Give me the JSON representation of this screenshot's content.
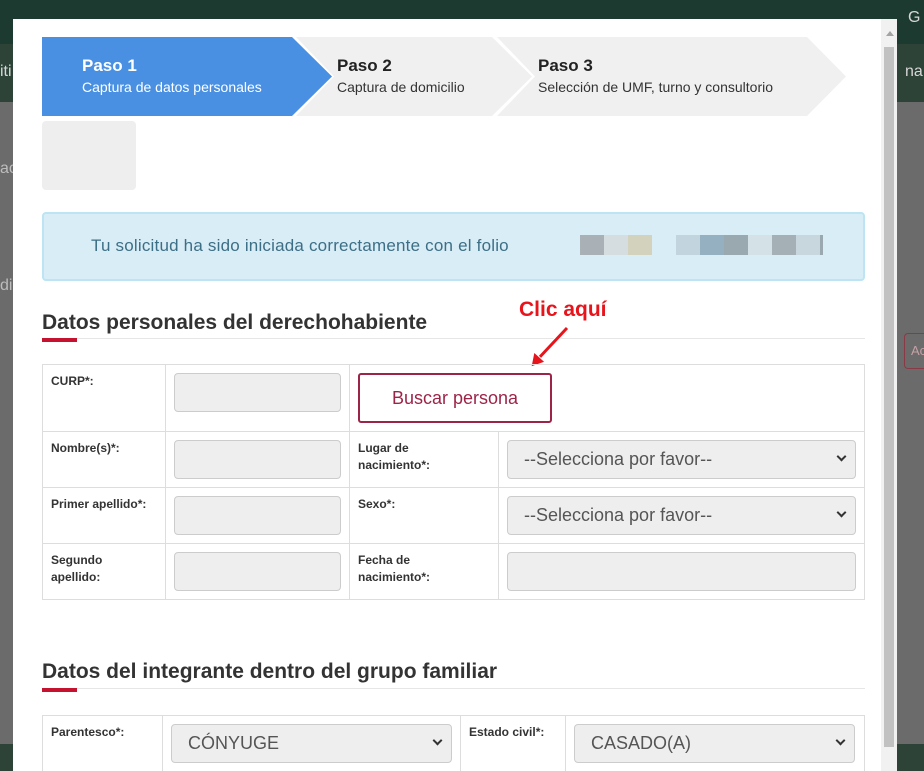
{
  "background": {
    "fragments": [
      "G",
      "iti",
      "na",
      "ac",
      "dig",
      "Ac"
    ]
  },
  "stepper": [
    {
      "title": "Paso 1",
      "subtitle": "Captura de datos personales",
      "active": true
    },
    {
      "title": "Paso 2",
      "subtitle": "Captura de domicilio",
      "active": false
    },
    {
      "title": "Paso 3",
      "subtitle": "Selección de UMF, turno y consultorio",
      "active": false
    }
  ],
  "alert": {
    "text": "Tu solicitud ha sido iniciada correctamente con el folio"
  },
  "section1": {
    "title": "Datos personales del derechohabiente"
  },
  "annotation": {
    "text": "Clic aquí"
  },
  "form1": {
    "curp_label": "CURP*:",
    "buscar_label": "Buscar persona",
    "nombre_label": "Nombre(s)*:",
    "lugar_label": "Lugar de nacimiento*:",
    "lugar_value": "--Selecciona por favor--",
    "primer_apellido_label": "Primer apellido*:",
    "sexo_label": "Sexo*:",
    "sexo_value": "--Selecciona por favor--",
    "segundo_apellido_label": "Segundo apellido:",
    "fecha_label": "Fecha de nacimiento*:"
  },
  "section2": {
    "title": "Datos del integrante dentro del grupo familiar"
  },
  "form2": {
    "parentesco_label": "Parentesco*:",
    "parentesco_value": "CÓNYUGE",
    "estado_civil_label": "Estado civil*:",
    "estado_civil_value": "CASADO(A)"
  },
  "colors": {
    "step_active": "#4a90e2",
    "step_inactive": "#f0f0f0",
    "accent_red": "#c4122f",
    "button_border": "#9d2449",
    "alert_bg": "#d9edf7",
    "annotation_red": "#e8141c"
  }
}
